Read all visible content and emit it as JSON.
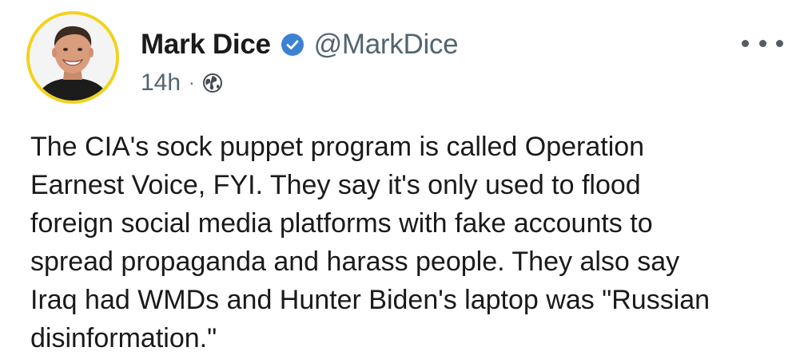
{
  "post": {
    "author_name": "Mark Dice",
    "handle": "@MarkDice",
    "timestamp": "14h",
    "separator": "·",
    "verified_icon": "verified-badge-icon",
    "visibility_icon": "globe-icon",
    "more_icon": "more-options-icon",
    "accent_color": "#3b82d6",
    "avatar_ring_color": "#f2d21b",
    "text_lines": [
      "The CIA's sock puppet program is called Operation",
      "Earnest Voice, FYI. They say it's only used to flood",
      "foreign social media platforms with fake accounts to",
      "spread propaganda and harass people. They also say",
      "Iraq had WMDs and Hunter Biden's laptop was \"Russian",
      "disinformation.\""
    ]
  }
}
